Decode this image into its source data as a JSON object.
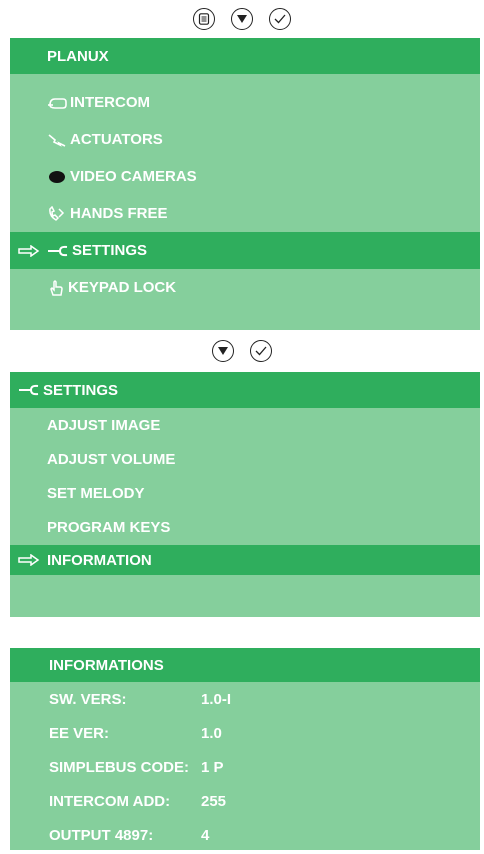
{
  "top_controls": {
    "icons": [
      "menu-icon",
      "down-arrow-icon",
      "check-icon"
    ]
  },
  "main_menu": {
    "title": "PLANUX",
    "items": [
      {
        "label": "INTERCOM",
        "icon": "intercom-icon"
      },
      {
        "label": "ACTUATORS",
        "icon": "actuators-icon"
      },
      {
        "label": "VIDEO CAMERAS",
        "icon": "camera-icon"
      },
      {
        "label": "HANDS FREE",
        "icon": "handsfree-icon"
      },
      {
        "label": "SETTINGS",
        "icon": "wrench-icon",
        "selected": true
      },
      {
        "label": "KEYPAD LOCK",
        "icon": "hand-icon"
      }
    ]
  },
  "mid_controls": {
    "icons": [
      "down-arrow-icon",
      "check-icon"
    ]
  },
  "settings_menu": {
    "title": "SETTINGS",
    "items": [
      {
        "label": "ADJUST IMAGE"
      },
      {
        "label": "ADJUST VOLUME"
      },
      {
        "label": "SET MELODY"
      },
      {
        "label": "PROGRAM KEYS"
      },
      {
        "label": "INFORMATION",
        "selected": true
      }
    ]
  },
  "informations": {
    "title": "INFORMATIONS",
    "rows": [
      {
        "label": "SW. VERS:",
        "value": "1.0-I"
      },
      {
        "label": "EE VER:",
        "value": "1.0"
      },
      {
        "label": "SIMPLEBUS CODE:",
        "value": "1 P"
      },
      {
        "label": "INTERCOM ADD:",
        "value": "255"
      },
      {
        "label": "OUTPUT 4897:",
        "value": "4"
      }
    ]
  },
  "colors": {
    "header_green": "#2fae5d",
    "panel_green": "#85cf9c",
    "text": "#ffffff"
  }
}
